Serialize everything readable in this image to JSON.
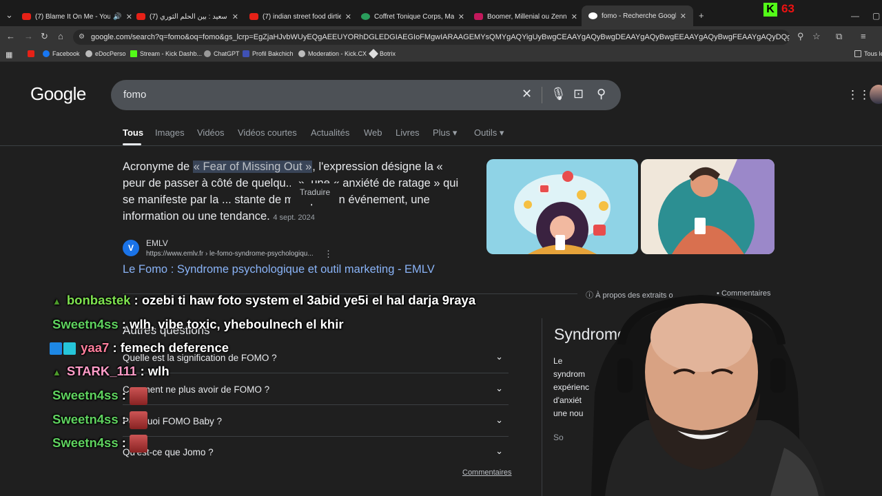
{
  "browser": {
    "tabs": [
      {
        "title": "(7) Blame It On Me - YouTube",
        "audio": "🔊"
      },
      {
        "title": "(7) قيس سعيد : بين الحلم الثوري"
      },
      {
        "title": "(7) indian street food dirtiest c"
      },
      {
        "title": "Coffret Tonique Corps, Mains, C"
      },
      {
        "title": "Boomer, Millenial ou Zennial : c"
      },
      {
        "title": "fomo - Recherche Google"
      }
    ],
    "new_tab": "+",
    "url": "google.com/search?q=fomo&oq=fomo&gs_lcrp=EgZjaHJvbWUyEQgAEEUYORhDGLEDGIAEGIoFMgwIARAAGEMYsQMYgAQYigUyBwgCEAAYgAQyBwgDEAAYgAQyBwgEEAAYgAQyBwgFEAAYgAQyDQgFEC4YxwEY0QMYgAQyBwgGEAAYgAQyBwgHEAA...",
    "bookmarks": [
      "Facebook",
      "eDocPerso",
      "Stream - Kick Dashb...",
      "ChatGPT",
      "Profil Bakchich",
      "Moderation - Kick.CX",
      "Botrix"
    ],
    "all_bookmarks": "Tous le"
  },
  "stream": {
    "viewers": "63",
    "kick": "K"
  },
  "google": {
    "logo": "Google",
    "query": "fomo",
    "nav": [
      "Tous",
      "Images",
      "Vidéos",
      "Vidéos courtes",
      "Actualités",
      "Web",
      "Livres",
      "Plus ▾",
      "Outils ▾"
    ],
    "snippet": {
      "pre": "Acronyme de ",
      "highlight": "« Fear of Missing Out »",
      "post": ", l'expression désigne la « peur de passer à côté de quelqu... », une « anxiété de ratage » qui se manifeste par la ... stante de manquer un événement, une information ou une tendance.",
      "date": "4 sept. 2024"
    },
    "traduire": "Traduire",
    "source": {
      "icon": "V",
      "name": "EMLV",
      "url": "https://www.emlv.fr › le-fomo-syndrome-psychologiqu...",
      "more": "⋮",
      "link": "Le Fomo : Syndrome psychologique et outil marketing - EMLV"
    },
    "about": "À propos des extraits o",
    "comments": "Commentaires",
    "paa_title": "Autres questions",
    "paa": [
      "Quelle est la signification de FOMO ?",
      "Comment ne plus avoir de FOMO ?",
      "Pourquoi FOMO Baby ?",
      "Qu'est-ce que Jomo ?"
    ],
    "comments2": "Commentaires",
    "kp": {
      "title": "Syndrome",
      "body": "Le syndrom expérienc d'anxiét une nou quelco",
      "so": "So",
      "more": "⋮"
    }
  },
  "chat": [
    {
      "user": "bonbastek",
      "color": "#7ee24f",
      "msg": ": ozebi ti haw foto system el 3abid ye5i el hal darja 9raya",
      "leaf": true
    },
    {
      "user": "Sweetn4ss",
      "color": "#5fd35f",
      "msg": ": wlh, vibe toxic, yheboulnech el khir"
    },
    {
      "user": "yaa7",
      "color": "#ff7e9c",
      "msg": ": femech deference",
      "badges": true
    },
    {
      "user": "STARK_111",
      "color": "#ff9cc8",
      "msg": ": wlh",
      "leaf": true
    },
    {
      "user": "Sweetn4ss",
      "color": "#5fd35f",
      "msg": ":",
      "emote": true
    },
    {
      "user": "Sweetn4ss",
      "color": "#5fd35f",
      "msg": ":",
      "emote": true
    },
    {
      "user": "Sweetn4ss",
      "color": "#5fd35f",
      "msg": ":",
      "emote": true
    }
  ],
  "colors": {
    "link": "#8ab4f8",
    "bg": "#1f1f1f",
    "chip": "#4d5156"
  }
}
